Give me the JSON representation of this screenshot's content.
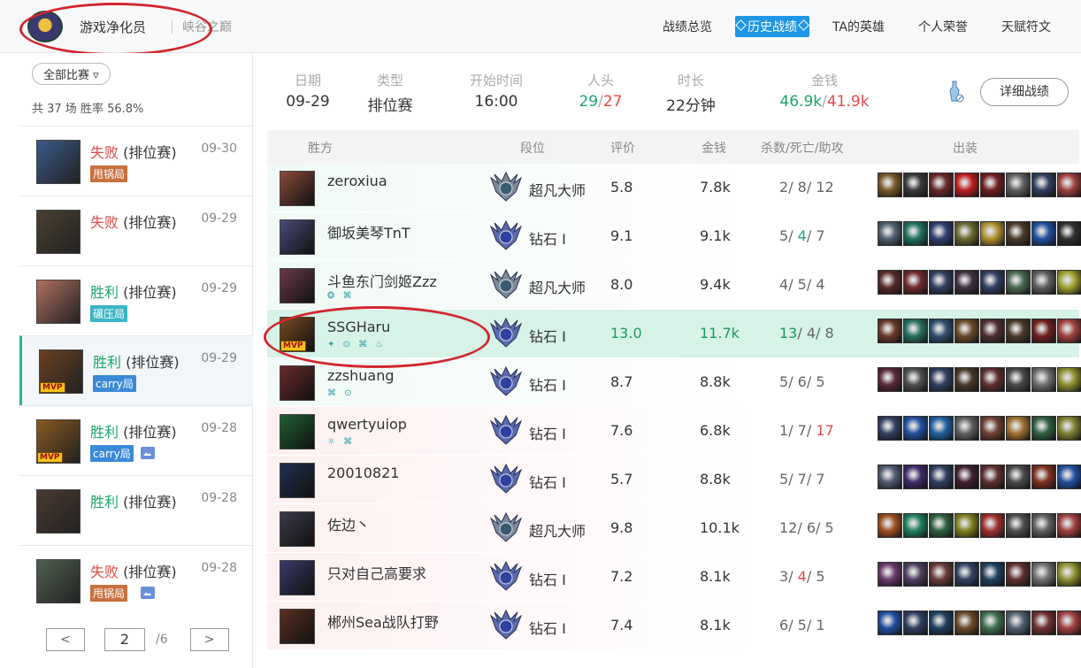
{
  "header": {
    "player_name": "游戏净化员",
    "server": "峡谷之巅"
  },
  "nav": {
    "tabs": [
      "战绩总览",
      "历史战绩",
      "TA的英雄",
      "个人荣誉",
      "天赋符文"
    ],
    "active": 1
  },
  "sidebar": {
    "filter_label": "全部比赛",
    "summary": "共 37 场   胜率 56.8%",
    "matches": [
      {
        "result": "失败",
        "mode": "(排位赛)",
        "date": "09-30",
        "tag": "甩锅局",
        "tag_color": "orange",
        "win": false,
        "mvp": false,
        "pic": false,
        "color": "#3a5a8a"
      },
      {
        "result": "失败",
        "mode": "(排位赛)",
        "date": "09-29",
        "tag": "",
        "tag_color": "",
        "win": false,
        "mvp": false,
        "pic": false,
        "color": "#4a4030"
      },
      {
        "result": "胜利",
        "mode": "(排位赛)",
        "date": "09-29",
        "tag": "碾压局",
        "tag_color": "teal",
        "win": true,
        "mvp": false,
        "pic": false,
        "color": "#b07060"
      },
      {
        "result": "胜利",
        "mode": "(排位赛)",
        "date": "09-29",
        "tag": "carry局",
        "tag_color": "blue",
        "win": true,
        "mvp": true,
        "pic": false,
        "color": "#6a4020"
      },
      {
        "result": "胜利",
        "mode": "(排位赛)",
        "date": "09-28",
        "tag": "carry局",
        "tag_color": "blue",
        "win": true,
        "mvp": true,
        "pic": true,
        "color": "#8a5a20"
      },
      {
        "result": "胜利",
        "mode": "(排位赛)",
        "date": "09-28",
        "tag": "",
        "tag_color": "",
        "win": true,
        "mvp": false,
        "pic": false,
        "color": "#4a3a30"
      },
      {
        "result": "失败",
        "mode": "(排位赛)",
        "date": "09-28",
        "tag": "甩锅局",
        "tag_color": "orange",
        "win": false,
        "mvp": false,
        "pic": true,
        "color": "#506050"
      }
    ],
    "pager": {
      "prev": "<",
      "page": "2",
      "total": "/6",
      "next": ">"
    }
  },
  "game": {
    "labels": {
      "date": "日期",
      "type": "类型",
      "start": "开始时间",
      "kills": "人头",
      "duration": "时长",
      "gold": "金钱"
    },
    "values": {
      "date": "09-29",
      "type": "排位赛",
      "start": "16:00",
      "kills_win": "29",
      "kills_sep": "/",
      "kills_lose": "27",
      "duration": "22分钟",
      "gold_win": "46.9k",
      "gold_sep": "/",
      "gold_lose": "41.9k"
    },
    "detail_button": "详细战绩"
  },
  "table": {
    "headers": {
      "side": "胜方",
      "rank": "段位",
      "score": "评价",
      "gold": "金钱",
      "kda": "杀数/死亡/助攻",
      "items": "出装"
    },
    "rows": [
      {
        "name": "zeroxiua",
        "rank": "超凡大师",
        "score": "5.8",
        "gold": "7.8k",
        "k": "2",
        "d": "8",
        "a": "12",
        "side": "win",
        "hl": false,
        "mvp": false,
        "runes": "",
        "avatar": "#8a4a3a",
        "items": [
          "#7a5a2a",
          "#3a3a3a",
          "#6a2a2a",
          "#c02020",
          "#702020",
          "#606060",
          "#304060",
          "#a04040"
        ]
      },
      {
        "name": "御坂美琴TnT",
        "rank": "钻石 I",
        "score": "9.1",
        "gold": "9.1k",
        "k": "5",
        "d": "4",
        "a": "7",
        "side": "win",
        "hl": false,
        "mvp": false,
        "runes": "",
        "avatar": "#4a4a7a",
        "items": [
          "#506070",
          "#207060",
          "#304070",
          "#6a6a30",
          "#b09030",
          "#4a3a2a",
          "#2050a0",
          "#303030"
        ]
      },
      {
        "name": "斗鱼东门剑姬Zzz",
        "rank": "超凡大师",
        "score": "8.0",
        "gold": "9.4k",
        "k": "4",
        "d": "5",
        "a": "4",
        "side": "win",
        "hl": false,
        "mvp": false,
        "runes": "❂ ⌘",
        "avatar": "#6a3a4a",
        "items": [
          "#5a2a2a",
          "#702a2a",
          "#304060",
          "#403040",
          "#304060",
          "#4a6a50",
          "#606060",
          "#a0a030"
        ]
      },
      {
        "name": "SSGHaru",
        "rank": "钻石 I",
        "score": "13.0",
        "gold": "11.7k",
        "k": "13",
        "d": "4",
        "a": "8",
        "side": "win",
        "hl": true,
        "mvp": true,
        "runes": "✦ ⊙ ⌘ ♨",
        "avatar": "#7a4a20",
        "items": [
          "#6a3a2a",
          "#2a7060",
          "#305070",
          "#6a4a2a",
          "#503030",
          "#4a3a2a",
          "#702020",
          "#a04040"
        ]
      },
      {
        "name": "zzshuang",
        "rank": "钻石 I",
        "score": "8.7",
        "gold": "8.8k",
        "k": "5",
        "d": "6",
        "a": "5",
        "side": "win",
        "hl": false,
        "mvp": false,
        "runes": "⌘ ⊙",
        "avatar": "#6a2a2a",
        "items": [
          "#5a2a3a",
          "#505050",
          "#304060",
          "#4a3a2a",
          "#603030",
          "#4a4a4a",
          "#707070",
          "#909030"
        ]
      },
      {
        "name": "qwertyuiop",
        "rank": "钻石 I",
        "score": "7.6",
        "gold": "6.8k",
        "k": "1",
        "d": "7",
        "a": "17",
        "side": "lose",
        "hl": false,
        "mvp": false,
        "runes": "☼ ⌘",
        "avatar": "#206030",
        "items": [
          "#304060",
          "#2050a0",
          "#2060a0",
          "#606060",
          "#704030",
          "#a07030",
          "#306040",
          "#808030"
        ]
      },
      {
        "name": "20010821",
        "rank": "钻石 I",
        "score": "5.7",
        "gold": "8.8k",
        "k": "5",
        "d": "7",
        "a": "7",
        "side": "lose",
        "hl": false,
        "mvp": false,
        "runes": "",
        "avatar": "#203050",
        "items": [
          "#505a70",
          "#402a6a",
          "#304060",
          "#402030",
          "#603030",
          "#4a4a4a",
          "#803020",
          "#2050a0"
        ]
      },
      {
        "name": "佐边丶",
        "rank": "超凡大师",
        "score": "9.8",
        "gold": "10.1k",
        "k": "12",
        "d": "6",
        "a": "5",
        "side": "lose",
        "hl": false,
        "mvp": false,
        "runes": "",
        "avatar": "#3a3a4a",
        "items": [
          "#a05020",
          "#208060",
          "#306040",
          "#808020",
          "#a03030",
          "#505050",
          "#606060",
          "#a04040"
        ]
      },
      {
        "name": "只对自己高要求",
        "rank": "钻石 I",
        "score": "7.2",
        "gold": "8.1k",
        "k": "3",
        "d": "4",
        "a": "5",
        "side": "lose",
        "hl": false,
        "mvp": false,
        "runes": "",
        "avatar": "#3a3a6a",
        "items": [
          "#6a3a6a",
          "#504060",
          "#6a3a3a",
          "#304060",
          "#204060",
          "#603030",
          "#707070",
          "#909030"
        ]
      },
      {
        "name": "郴州Sea战队打野",
        "rank": "钻石 I",
        "score": "7.4",
        "gold": "8.1k",
        "k": "6",
        "d": "5",
        "a": "1",
        "side": "lose",
        "hl": false,
        "mvp": false,
        "runes": "",
        "avatar": "#5a3020",
        "items": [
          "#2050a0",
          "#304060",
          "#204060",
          "#6a4a2a",
          "#407050",
          "#506070",
          "#703030",
          "#a04040"
        ]
      }
    ]
  }
}
